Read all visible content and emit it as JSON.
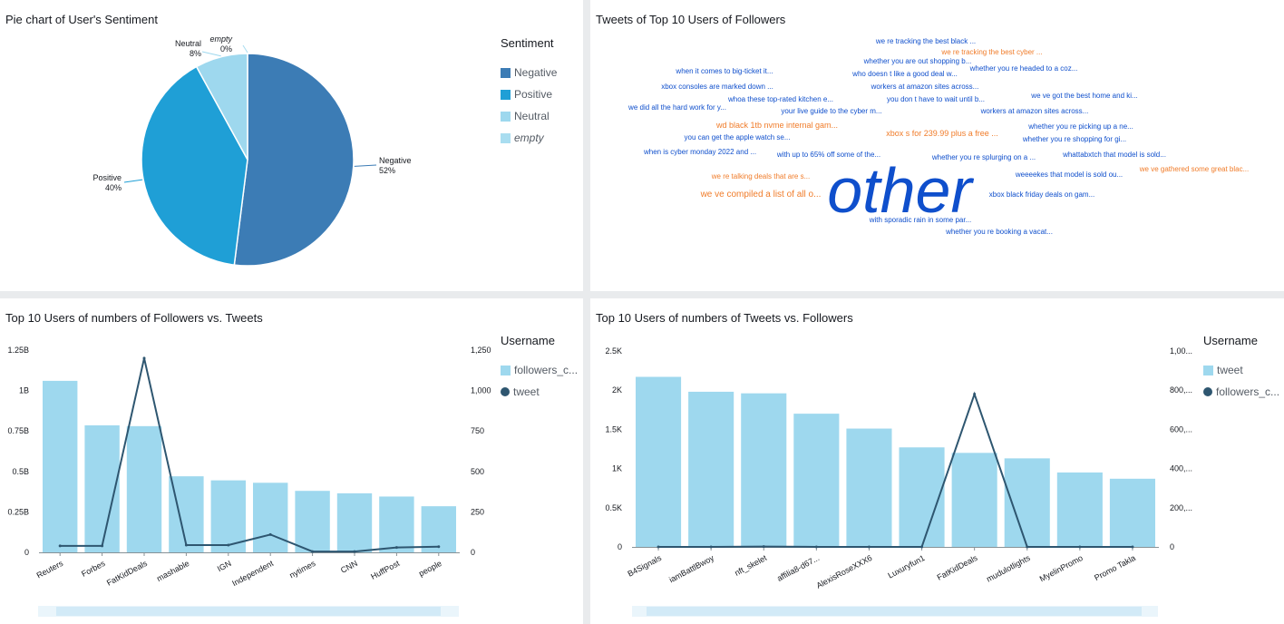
{
  "colors": {
    "negative": "#3c7cb5",
    "positive": "#1f9fd6",
    "neutral": "#9ed8ee",
    "empty": "#a9ddf0",
    "bar": "#9ed8ee",
    "line": "#2e5670",
    "cloud_blue": "#0f4fcc",
    "cloud_orange": "#f07c2a"
  },
  "panels": {
    "pie": {
      "title": "Pie chart of User's Sentiment",
      "legend_title": "Sentiment",
      "legend": [
        "Negative",
        "Positive",
        "Neutral",
        "empty"
      ]
    },
    "cloud": {
      "title": "Tweets of Top 10 Users of Followers"
    },
    "bar1": {
      "title": "Top 10 Users of numbers of Followers vs. Tweets",
      "legend_title": "Username",
      "legend": [
        "followers_c...",
        "tweet"
      ]
    },
    "bar2": {
      "title": "Top 10 Users of numbers of Tweets vs. Followers",
      "legend_title": "Username",
      "legend": [
        "tweet",
        "followers_c..."
      ]
    }
  },
  "wordcloud": [
    {
      "text": "we re tracking the best black ...",
      "color": "blue",
      "size": 8
    },
    {
      "text": "we re tracking the best cyber ...",
      "color": "orange",
      "size": 8
    },
    {
      "text": "whether you are out shopping b...",
      "color": "blue",
      "size": 8
    },
    {
      "text": "when it comes to big-ticket it...",
      "color": "blue",
      "size": 8
    },
    {
      "text": "who doesn t like a good deal w...",
      "color": "blue",
      "size": 8
    },
    {
      "text": "whether you re headed to a coz...",
      "color": "blue",
      "size": 8
    },
    {
      "text": "xbox consoles are marked down ...",
      "color": "blue",
      "size": 8
    },
    {
      "text": "workers at amazon sites across...",
      "color": "blue",
      "size": 8
    },
    {
      "text": "whoa these top-rated kitchen e...",
      "color": "blue",
      "size": 8
    },
    {
      "text": "you don t have to wait until b...",
      "color": "blue",
      "size": 8
    },
    {
      "text": "we ve got the best home and ki...",
      "color": "blue",
      "size": 8
    },
    {
      "text": "we did all the hard work for y...",
      "color": "blue",
      "size": 8
    },
    {
      "text": "your live guide to the cyber m...",
      "color": "blue",
      "size": 8
    },
    {
      "text": "workers at amazon sites across...",
      "color": "blue",
      "size": 8
    },
    {
      "text": "wd black 1tb nvme internal gam...",
      "color": "orange",
      "size": 9
    },
    {
      "text": "whether you re picking up a ne...",
      "color": "blue",
      "size": 8
    },
    {
      "text": "you can get the apple watch se...",
      "color": "blue",
      "size": 8
    },
    {
      "text": "xbox s for 239.99 plus a free ...",
      "color": "orange",
      "size": 9
    },
    {
      "text": "whether you re shopping for gi...",
      "color": "blue",
      "size": 8
    },
    {
      "text": "when is cyber monday 2022 and ...",
      "color": "blue",
      "size": 8
    },
    {
      "text": "with up to 65% off some of the...",
      "color": "blue",
      "size": 8
    },
    {
      "text": "whether you re splurging on a ...",
      "color": "blue",
      "size": 8
    },
    {
      "text": "whattabxtch that model is sold...",
      "color": "blue",
      "size": 8
    },
    {
      "text": "we re talking deals that are s...",
      "color": "orange",
      "size": 8
    },
    {
      "text": "weeeekes that model is sold ou...",
      "color": "blue",
      "size": 8
    },
    {
      "text": "we ve gathered some great blac...",
      "color": "orange",
      "size": 8
    },
    {
      "text": "other",
      "color": "blue",
      "size": 70
    },
    {
      "text": "we ve compiled a list of all o...",
      "color": "orange",
      "size": 10
    },
    {
      "text": "xbox black friday deals on gam...",
      "color": "blue",
      "size": 8
    },
    {
      "text": "with sporadic rain in some par...",
      "color": "blue",
      "size": 8
    },
    {
      "text": "whether you re booking a vacat...",
      "color": "blue",
      "size": 8
    }
  ],
  "chart_data": [
    {
      "type": "pie",
      "title": "Pie chart of User's Sentiment",
      "legend_title": "Sentiment",
      "slices": [
        {
          "label": "Negative",
          "value": 52,
          "pct_label": "52%"
        },
        {
          "label": "Positive",
          "value": 40,
          "pct_label": "40%"
        },
        {
          "label": "Neutral",
          "value": 8,
          "pct_label": "8%"
        },
        {
          "label": "empty",
          "value": 0,
          "pct_label": "0%"
        }
      ]
    },
    {
      "type": "bar",
      "title": "Top 10 Users of numbers of Followers vs. Tweets",
      "legend_title": "Username",
      "categories": [
        "Reuters",
        "Forbes",
        "FatKidDeals",
        "mashable",
        "IGN",
        "Independent",
        "nytimes",
        "CNN",
        "HuffPost",
        "people"
      ],
      "series": [
        {
          "name": "followers_c...",
          "type": "bar",
          "axis": "left",
          "values": [
            1060000000,
            785000000,
            780000000,
            470000000,
            445000000,
            430000000,
            380000000,
            365000000,
            345000000,
            285000000
          ]
        },
        {
          "name": "tweet",
          "type": "line",
          "axis": "right",
          "values": [
            40,
            40,
            1200,
            45,
            45,
            110,
            5,
            5,
            30,
            35
          ]
        }
      ],
      "left_ticks": [
        "0",
        "0.25B",
        "0.5B",
        "0.75B",
        "1B",
        "1.25B"
      ],
      "left_max": 1250000000,
      "right_ticks": [
        "0",
        "250",
        "500",
        "750",
        "1,000",
        "1,250"
      ],
      "right_max": 1250
    },
    {
      "type": "bar",
      "title": "Top 10 Users of numbers of Tweets vs. Followers",
      "legend_title": "Username",
      "categories": [
        "B4Signals",
        "iamBattlBwoy",
        "nft_skelet",
        "affilia8-d67...",
        "AlexisRoseXXX6",
        "Luxuryfun1",
        "FatKidDeals",
        "mudulotlights",
        "MyelinPromo",
        "Promo Takla"
      ],
      "series": [
        {
          "name": "tweet",
          "type": "bar",
          "axis": "left",
          "values": [
            2170,
            1980,
            1960,
            1700,
            1510,
            1270,
            1200,
            1130,
            950,
            870
          ]
        },
        {
          "name": "followers_c...",
          "type": "line",
          "axis": "right",
          "values": [
            0,
            0,
            2,
            0,
            0,
            0,
            780,
            0,
            0,
            0
          ]
        }
      ],
      "left_ticks": [
        "0",
        "0.5K",
        "1K",
        "1.5K",
        "2K",
        "2.5K"
      ],
      "left_max": 2500,
      "right_ticks": [
        "0",
        "200,...",
        "400,...",
        "600,...",
        "800,...",
        "1,00..."
      ],
      "right_max": 1000
    }
  ]
}
